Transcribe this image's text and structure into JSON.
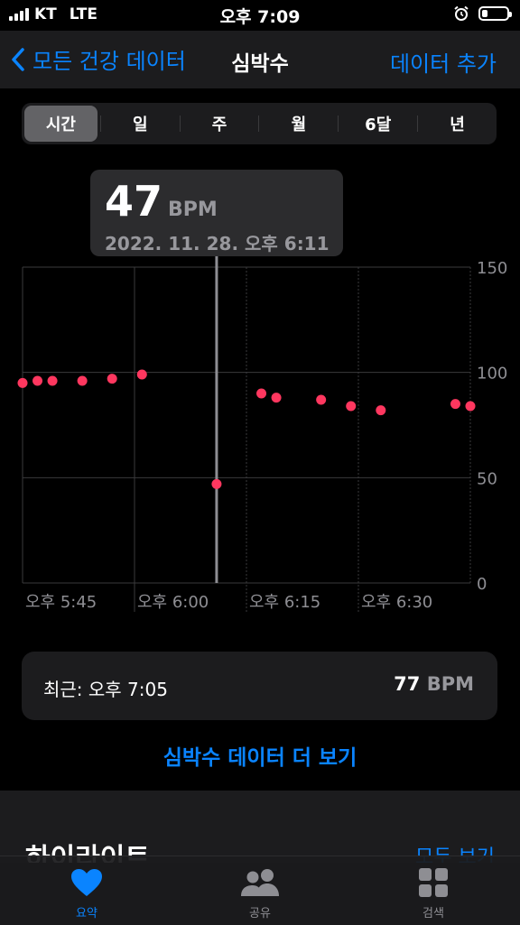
{
  "status_bar": {
    "carrier": "KT",
    "network": "LTE",
    "time": "오후 7:09"
  },
  "nav": {
    "back_label": "모든 건강 데이터",
    "title": "심박수",
    "add_label": "데이터 추가"
  },
  "segments": [
    {
      "label": "시간",
      "selected": true
    },
    {
      "label": "일",
      "selected": false
    },
    {
      "label": "주",
      "selected": false
    },
    {
      "label": "월",
      "selected": false
    },
    {
      "label": "6달",
      "selected": false
    },
    {
      "label": "년",
      "selected": false
    }
  ],
  "tooltip": {
    "value": "47",
    "unit": "BPM",
    "datetime": "2022. 11. 28. 오후 6:11"
  },
  "chart_data": {
    "type": "scatter",
    "y_ticks": [
      "150",
      "100",
      "50",
      "0"
    ],
    "ylim": [
      0,
      150
    ],
    "x_ticks": [
      {
        "label": "오후 5:45",
        "minute": 45
      },
      {
        "label": "오후 6:00",
        "minute": 60
      },
      {
        "label": "오후 6:15",
        "minute": 75
      },
      {
        "label": "오후 6:30",
        "minute": 90
      }
    ],
    "xlim_minutes": [
      45,
      105
    ],
    "selected_minute": 71,
    "point_color": "#ff375f",
    "points": [
      {
        "x": 45,
        "y": 95
      },
      {
        "x": 47,
        "y": 96
      },
      {
        "x": 49,
        "y": 96
      },
      {
        "x": 53,
        "y": 96
      },
      {
        "x": 57,
        "y": 97
      },
      {
        "x": 61,
        "y": 99
      },
      {
        "x": 71,
        "y": 47
      },
      {
        "x": 77,
        "y": 90
      },
      {
        "x": 79,
        "y": 88
      },
      {
        "x": 85,
        "y": 87
      },
      {
        "x": 89,
        "y": 84
      },
      {
        "x": 93,
        "y": 82
      },
      {
        "x": 103,
        "y": 85
      },
      {
        "x": 105,
        "y": 84
      }
    ]
  },
  "latest": {
    "label": "최근: 오후 7:05",
    "value": "77",
    "unit": "BPM"
  },
  "more_link": "심박수 데이터 더 보기",
  "highlights": {
    "title": "하이라이트",
    "show_all": "모두 보기"
  },
  "tabbar": [
    {
      "label": "요약",
      "icon": "heart-icon",
      "active": true
    },
    {
      "label": "공유",
      "icon": "people-icon",
      "active": false
    },
    {
      "label": "검색",
      "icon": "grid-icon",
      "active": false
    }
  ],
  "colors": {
    "accent": "#0a84ff",
    "heart_rate": "#ff375f",
    "background": "#000000",
    "card": "#1c1c1e"
  }
}
